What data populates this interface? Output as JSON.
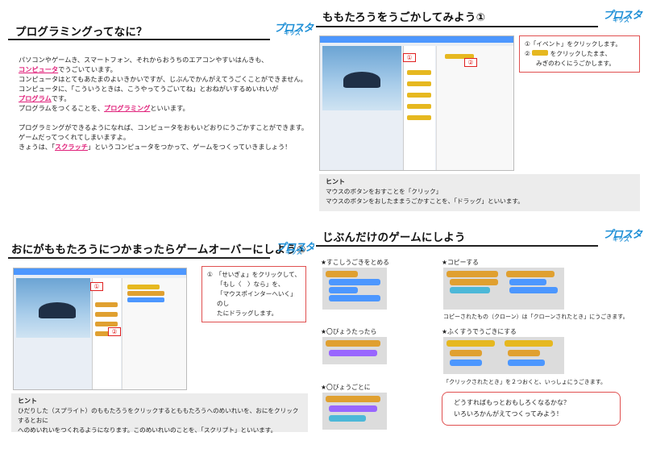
{
  "panel1": {
    "title": "プログラミングってなに？",
    "lines": [
      "パソコンやゲームき、スマートフォン、それからおうちのエアコンやすいはんきも、",
      "でうごいています。",
      "コンピュータはとてもあたまのよいきかいですが、じぶんでかんがえてうごくことができません。",
      "コンピュータに、「こういうときは、こうやってうごいてね」とおねがいするめいれいが",
      "です。",
      "プログラムをつくることを、",
      "といいます。",
      "プログラミングができるようになれば、コンピュータをおもいどおりにうごかすことができます。",
      "ゲームだってつくれてしまいますよ。",
      "きょうは、「",
      "」というコンピュータをつかって、ゲームをつくっていきましょう！"
    ],
    "kw_computer": "コンピュータ",
    "kw_program": "プログラム",
    "kw_programming": "プログラミング",
    "kw_scratch": "スクラッチ"
  },
  "panel2": {
    "title": "ももたろうをうごかしてみよう①",
    "callout_1": "①「イベント」をクリックします。",
    "callout_2a": "②",
    "callout_2b": "をクリックしたまま、",
    "callout_3": "みぎのわくにうごかします。",
    "hint_title": "ヒント",
    "hint_1": "マウスのボタンをおすことを「クリック」",
    "hint_2": "マウスのボタンをおしたままうごかすことを、「ドラッグ」といいます。",
    "badge1": "①",
    "badge2": "②"
  },
  "panel3": {
    "title": "おにがももたろうにつかまったらゲームオーバーにしよう①",
    "callout_1": "①　「せいぎょ」をクリックして、",
    "callout_2": "「もし〈　〉なら」を、",
    "callout_3": "「マウスポインターへいく」のし",
    "callout_4": "たにドラッグします。",
    "hint_title": "ヒント",
    "hint_1": "ひだりした（スプライト）のももたろうをクリックするとももたろうへのめいれいを、おにをクリックするとおに",
    "hint_2": "へのめいれいをつくれるようになります。このめいれいのことを、「スクリプト」といいます。",
    "badge1": "①",
    "badge2": "②"
  },
  "panel4": {
    "title": "じぶんだけのゲームにしよう",
    "h_slow": "★すこしうごきをとめる",
    "h_copy": "★コピーする",
    "h_points": "★〇びょうたったら",
    "h_many": "★ふくすうでうごきにする",
    "h_each": "★〇びょうごとに",
    "copy_note": "コピーされたもの（クローン）は「クローンされたとき」にうごきます。",
    "many_note": "「クリックされたとき」を２つおくと、いっしょにうごきます。",
    "note_1": "どうすればもっとおもしろくなるかな？",
    "note_2": "いろいろかんがえてつくってみよう！"
  },
  "logo": {
    "main": "プロスタ",
    "sub": "キッズ"
  },
  "colors": {
    "accent": "#e0207a",
    "brand": "#1e8fd6",
    "control": "#e0a030",
    "sensing": "#4cb8d8",
    "events": "#e6b820"
  }
}
